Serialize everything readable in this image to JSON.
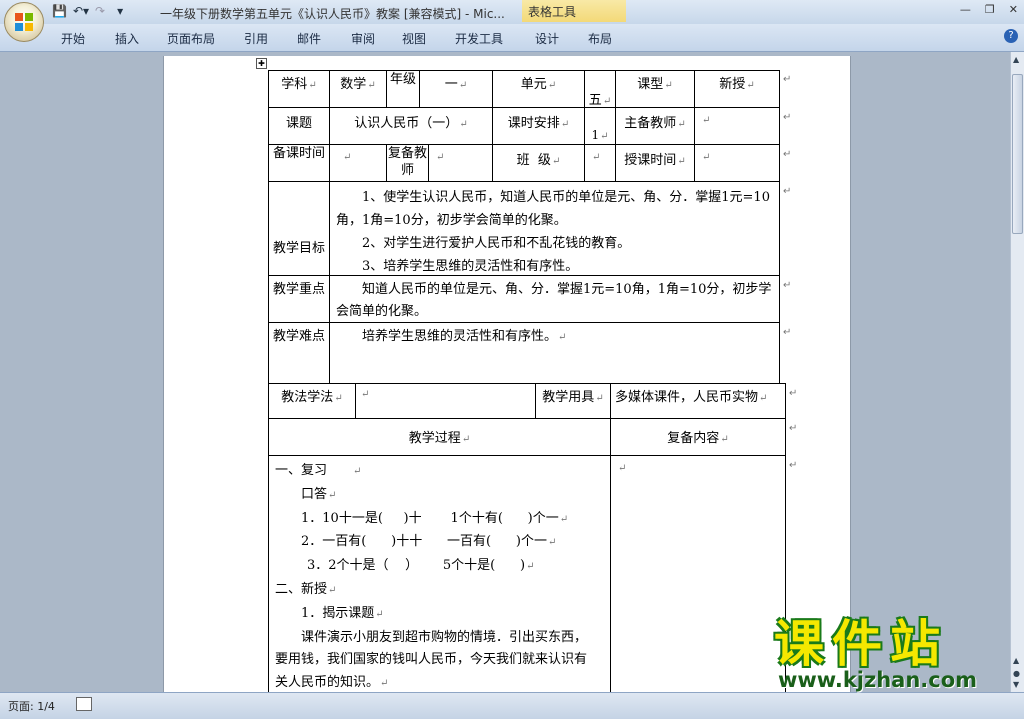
{
  "window": {
    "doc_title": "一年级下册数学第五单元《认识人民币》教案 [兼容模式] - Mic...",
    "context_tab": "表格工具"
  },
  "ribbon": {
    "tabs": [
      "开始",
      "插入",
      "页面布局",
      "引用",
      "邮件",
      "审阅",
      "视图",
      "开发工具",
      "设计",
      "布局"
    ]
  },
  "table": {
    "row1": {
      "subject_label": "学科",
      "subject_value": "数学",
      "grade_label": "年级",
      "grade_value": "一",
      "unit_label": "单元",
      "unit_value": "五",
      "lesson_type_label": "课型",
      "lesson_type_value": "新授"
    },
    "row2": {
      "topic_label": "课题",
      "topic_value": "认识人民币（一）",
      "hours_label": "课时安排",
      "hours_value": "1",
      "teacher_label": "主备教师"
    },
    "row3": {
      "prep_time_label": "备课时间",
      "review_teacher_label": "复备教师",
      "class_label": "班  级",
      "teach_time_label": "授课时间"
    },
    "goals": {
      "label": "教学目标",
      "items": [
        "1、使学生认识人民币，知道人民币的单位是元、角、分．掌握1元=10角，1角=10分，初步学会简单的化聚。",
        "2、对学生进行爱护人民币和不乱花钱的教育。",
        "3、培养学生思维的灵活性和有序性。"
      ]
    },
    "key_points": {
      "label": "教学重点",
      "text": "知道人民币的单位是元、角、分．掌握1元=10角，1角=10分，初步学会简单的化聚。"
    },
    "difficulty": {
      "label": "教学难点",
      "text": "培养学生思维的灵活性和有序性。"
    },
    "methods": {
      "label": "教法学法",
      "tools_label": "教学用具",
      "tools_value": "多媒体课件，人民币实物"
    },
    "process_header": {
      "process": "教学过程",
      "review": "复备内容"
    },
    "process_lines": [
      "一、复习",
      "口答",
      "1．10十一是(     )十       1个十有(      )个一",
      "2．一百有(      )十十      一百有(      )个一",
      "3．2个十是（    ）      5个十是(      )",
      "二、新授",
      "1．揭示课题",
      "课件演示小朋友到超市购物的情境．引出买东西，",
      "要用钱，我们国家的钱叫人民币，今天我们就来认识有",
      "关人民币的知识。"
    ]
  },
  "status": {
    "page": "页面: 1/4"
  },
  "watermark": {
    "big": "课件站",
    "url": "www.kjzhan.com"
  }
}
